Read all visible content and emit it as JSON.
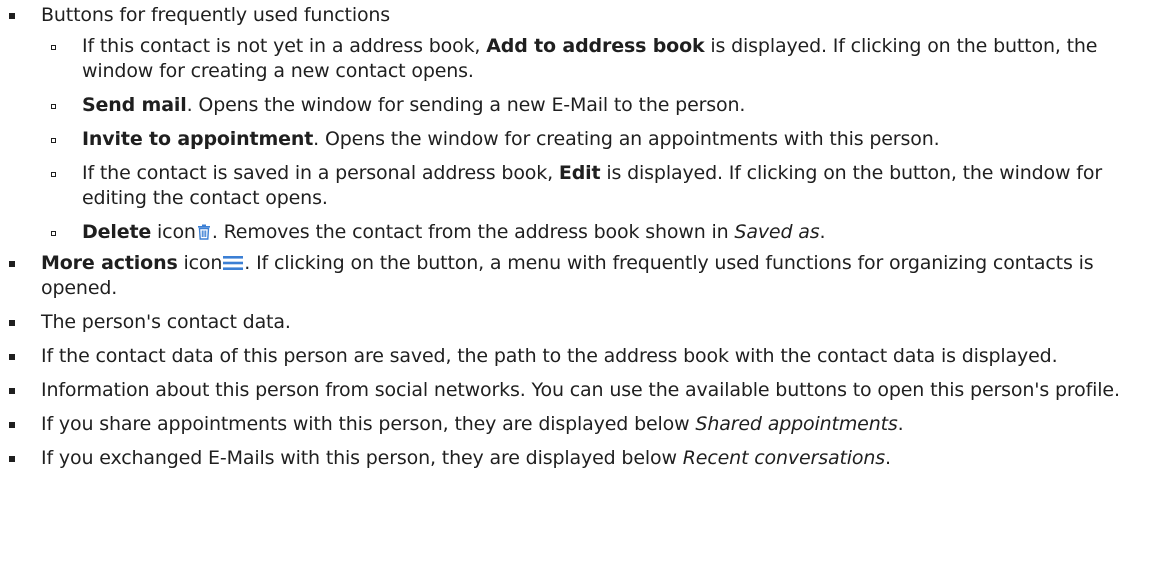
{
  "items": [
    {
      "text": "Buttons for frequently used functions"
    },
    {
      "sub": [
        {
          "pre": "If this contact is not yet in a address book, ",
          "bold": "Add to address book",
          "post": " is displayed. If clicking on the button, the window for creating a new contact opens."
        },
        {
          "bold": "Send mail",
          "post": ". Opens the window for sending a new E-Mail to the person."
        },
        {
          "bold": "Invite to appointment",
          "post": ". Opens the window for creating an appointments with this person."
        },
        {
          "pre": "If the contact is saved in a personal address book, ",
          "bold": "Edit",
          "post": " is displayed. If clicking on the button, the window for editing the contact opens."
        },
        {
          "bold": "Delete",
          "mid": " icon",
          "post": ". Removes the contact from the address book shown in ",
          "ital": "Saved as",
          "end": "."
        }
      ]
    },
    {
      "bold": "More actions",
      "mid": " icon",
      "post": ". If clicking on the button, a menu with frequently used functions for organizing contacts is opened."
    },
    {
      "text": "The person's contact data."
    },
    {
      "text": "If the contact data of this person are saved, the path to the address book with the contact data is displayed."
    },
    {
      "text": "Information about this person from social networks. You can use the available buttons to open this person's profile."
    },
    {
      "pre": "If you share appointments with this person, they are displayed below ",
      "ital": "Shared appointments",
      "end": "."
    },
    {
      "pre": "If you exchanged E-Mails with this person, they are displayed below ",
      "ital": "Recent conversations",
      "end": "."
    }
  ],
  "icons": {
    "delete": "trash-icon",
    "more_actions": "hamburger-menu-icon",
    "accent": "#3b7fd4"
  }
}
